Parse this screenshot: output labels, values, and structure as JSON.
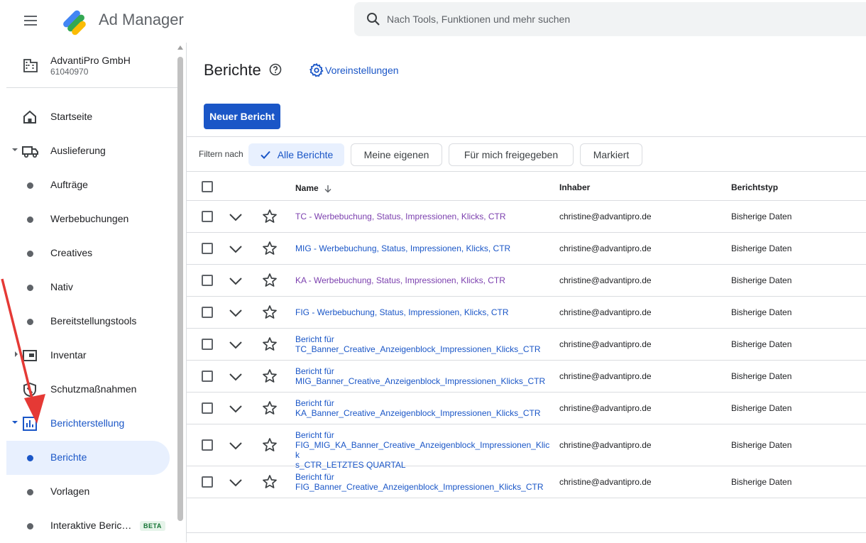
{
  "header": {
    "app_title": "Ad Manager",
    "search_placeholder": "Nach Tools, Funktionen und mehr suchen"
  },
  "org": {
    "name": "AdvantiPro GmbH",
    "id": "61040970"
  },
  "sidebar": {
    "items": [
      {
        "label": "Startseite"
      },
      {
        "label": "Auslieferung"
      },
      {
        "label": "Aufträge"
      },
      {
        "label": "Werbebuchungen"
      },
      {
        "label": "Creatives"
      },
      {
        "label": "Nativ"
      },
      {
        "label": "Bereitstellungstools"
      },
      {
        "label": "Inventar"
      },
      {
        "label": "Schutzmaßnahmen"
      },
      {
        "label": "Berichterstellung"
      },
      {
        "label": "Berichte"
      },
      {
        "label": "Vorlagen"
      },
      {
        "label": "Interaktive Beric…",
        "badge": "BETA"
      }
    ]
  },
  "main": {
    "title": "Berichte",
    "preferences_label": "Voreinstellungen",
    "new_report_label": "Neuer Bericht",
    "filter_label": "Filtern nach",
    "filters": [
      "Alle Berichte",
      "Meine eigenen",
      "Für mich freigegeben",
      "Markiert"
    ],
    "columns": {
      "name": "Name",
      "owner": "Inhaber",
      "type": "Berichtstyp"
    },
    "rows": [
      {
        "name": "TC - Werbebuchung, Status, Impressionen, Klicks, CTR",
        "owner": "christine@advantipro.de",
        "type": "Bisherige Daten"
      },
      {
        "name": "MIG - Werbebuchung, Status, Impressionen, Klicks, CTR",
        "owner": "christine@advantipro.de",
        "type": "Bisherige Daten"
      },
      {
        "name": "KA - Werbebuchung, Status, Impressionen, Klicks, CTR",
        "owner": "christine@advantipro.de",
        "type": "Bisherige Daten"
      },
      {
        "name": "FIG - Werbebuchung, Status, Impressionen, Klicks, CTR",
        "owner": "christine@advantipro.de",
        "type": "Bisherige Daten"
      },
      {
        "name_line1": "Bericht für",
        "name_line2": "TC_Banner_Creative_Anzeigenblock_Impressionen_Klicks_CTR",
        "owner": "christine@advantipro.de",
        "type": "Bisherige Daten"
      },
      {
        "name_line1": "Bericht für",
        "name_line2": "MIG_Banner_Creative_Anzeigenblock_Impressionen_Klicks_CTR",
        "owner": "christine@advantipro.de",
        "type": "Bisherige Daten"
      },
      {
        "name_line1": "Bericht für",
        "name_line2": "KA_Banner_Creative_Anzeigenblock_Impressionen_Klicks_CTR",
        "owner": "christine@advantipro.de",
        "type": "Bisherige Daten"
      },
      {
        "name_line1": "Bericht für",
        "name_line2": "FIG_MIG_KA_Banner_Creative_Anzeigenblock_Impressionen_Klick",
        "name_line3": "s_CTR_LETZTES QUARTAL",
        "owner": "christine@advantipro.de",
        "type": "Bisherige Daten"
      },
      {
        "name_line1": "Bericht für",
        "name_line2": "FIG_Banner_Creative_Anzeigenblock_Impressionen_Klicks_CTR",
        "owner": "christine@advantipro.de",
        "type": "Bisherige Daten"
      }
    ]
  },
  "colors": {
    "accent": "#1a56c7",
    "visited": "#7b3fae",
    "annotation_arrow": "#e53935"
  }
}
